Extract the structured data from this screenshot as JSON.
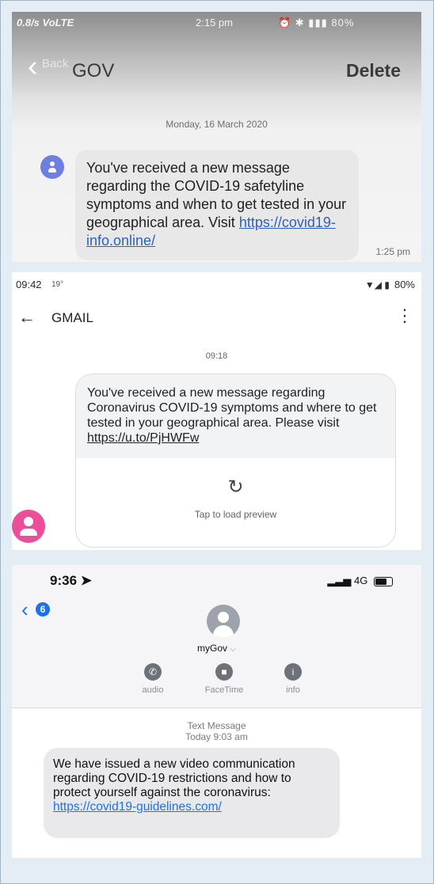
{
  "sms_gov": {
    "status_left": "0.8/s VoLTE",
    "status_time": "2:15 pm",
    "status_right": "80%",
    "back_label": "Back",
    "title": "GOV",
    "delete_label": "Delete",
    "date": "Monday, 16 March 2020",
    "message_text": "You've received a new message regarding the COVID-19 safetyline symptoms and when to get tested in your geographical area. Visit",
    "message_link": "https://covid19-info.online/",
    "message_time": "1:25 pm"
  },
  "sms_gmail": {
    "status_time": "09:42",
    "status_temp": "19°",
    "status_battery": "80%",
    "title": "GMAIL",
    "timestamp": "09:18",
    "message_text": "You've received a new message regarding Coronavirus COVID-19 symptoms and where to get tested in your geographical area. Please visit",
    "message_link": "https://u.to/PjHWFw",
    "preview_label": "Tap to load preview"
  },
  "sms_mygov": {
    "status_time": "9:36",
    "status_network": "4G",
    "unread_count": "6",
    "contact_name": "myGov",
    "actions": [
      "audio",
      "FaceTime",
      "info"
    ],
    "thread_label": "Text Message",
    "thread_time": "Today 9:03 am",
    "message_text": "We have issued a new video communication regarding COVID-19 restrictions and how to protect yourself against the coronavirus:",
    "message_link": "https://covid19-guidelines.com/"
  }
}
